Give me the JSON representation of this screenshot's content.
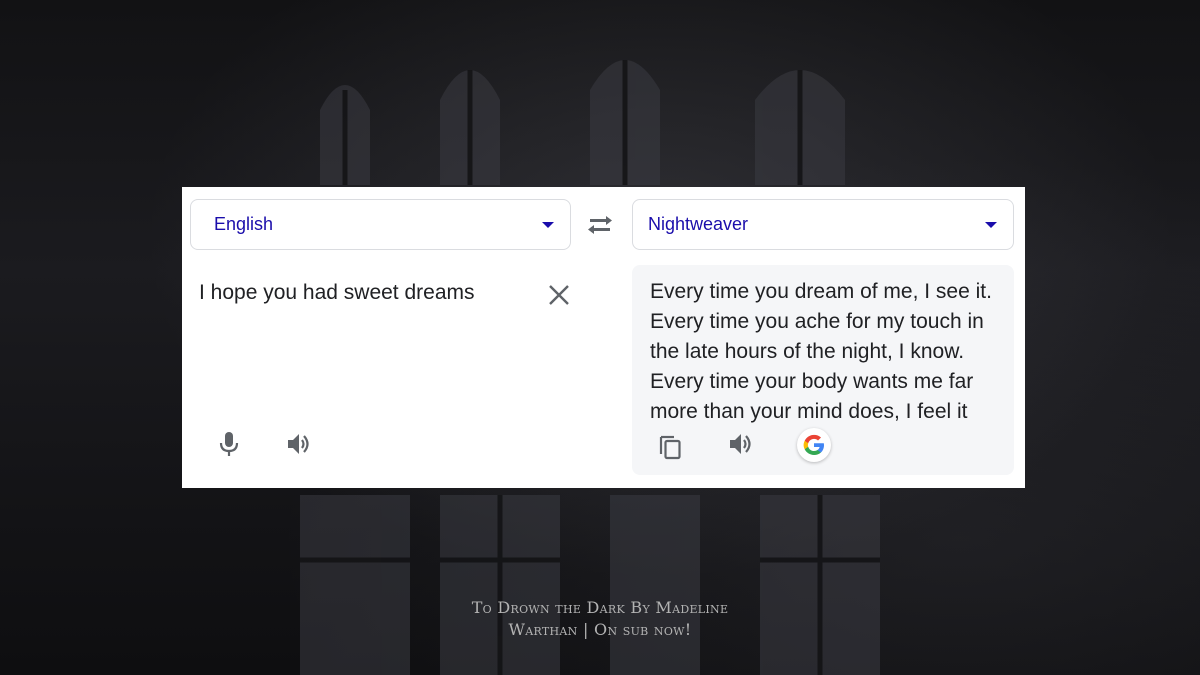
{
  "source": {
    "language": "English",
    "text": "I hope you had sweet dreams"
  },
  "target": {
    "language": "Nightweaver",
    "lines": [
      "Every time you dream of me, I see it.",
      "Every time you ache for my touch in",
      "the late hours of the night, I know.",
      "Every time your body wants me far",
      "more than your mind does, I feel it"
    ]
  },
  "icons": {
    "swap": "swap-arrows-icon",
    "clear": "close-icon",
    "mic": "microphone-icon",
    "speaker": "speaker-icon",
    "copy": "copy-icon",
    "brand": "google-g-icon"
  },
  "colors": {
    "language_label": "#1a0dab",
    "text": "#202124",
    "output_bg": "#f5f6f8"
  },
  "caption": {
    "line1": "To Drown the Dark By Madeline",
    "line2": "Warthan | On sub now!"
  }
}
